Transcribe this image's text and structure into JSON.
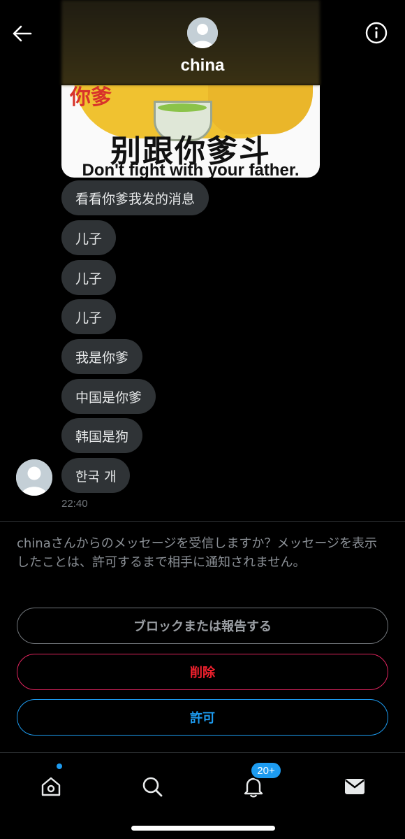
{
  "header": {
    "name": "china",
    "back_icon": "arrow-left-icon",
    "info_icon": "info-icon"
  },
  "meme": {
    "red_text": "你爹",
    "cn_text": "别跟你爹斗",
    "en_text": "Don't fight with your father."
  },
  "messages": [
    {
      "text": "看看你爹我发的消息"
    },
    {
      "text": "儿子"
    },
    {
      "text": "儿子"
    },
    {
      "text": "儿子"
    },
    {
      "text": "我是你爹"
    },
    {
      "text": "中国是你爹"
    },
    {
      "text": "韩国是狗"
    },
    {
      "text": "한국 개"
    }
  ],
  "timestamp": "22:40",
  "request": {
    "prompt": "chinaさんからのメッセージを受信しますか？メッセージを表示したことは、許可するまで相手に通知されません。",
    "block_label": "ブロックまたは報告する",
    "delete_label": "削除",
    "allow_label": "許可"
  },
  "tabbar": {
    "notifications_badge": "20+",
    "icons": [
      "home-icon",
      "search-icon",
      "bell-icon",
      "mail-icon"
    ]
  },
  "colors": {
    "accent": "#1d9bf0",
    "danger": "#f4212e",
    "bubble": "#2f3336"
  }
}
